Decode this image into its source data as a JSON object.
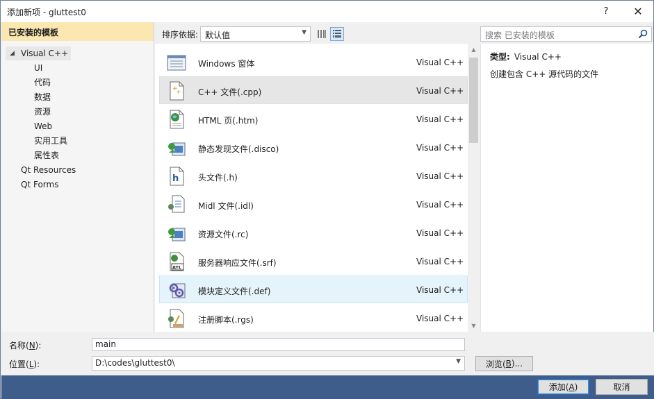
{
  "window": {
    "title": "添加新项 - gluttest0",
    "help": "?",
    "close": "✕"
  },
  "left": {
    "header": "已安装的模板",
    "root": "Visual C++",
    "children": [
      "UI",
      "代码",
      "数据",
      "资源",
      "Web",
      "实用工具",
      "属性表"
    ],
    "extra": [
      "Qt Resources",
      "Qt Forms"
    ]
  },
  "toolbar": {
    "sort_label": "排序依据:",
    "sort_value": "默认值",
    "search_placeholder": "搜索 已安装的模板"
  },
  "items": [
    {
      "name": "Windows 窗体",
      "lang": "Visual C++",
      "icon": "form-icon"
    },
    {
      "name": "C++ 文件(.cpp)",
      "lang": "Visual C++",
      "icon": "cpp-file-icon"
    },
    {
      "name": "HTML 页(.htm)",
      "lang": "Visual C++",
      "icon": "html-file-icon"
    },
    {
      "name": "静态发现文件(.disco)",
      "lang": "Visual C++",
      "icon": "disco-file-icon"
    },
    {
      "name": "头文件(.h)",
      "lang": "Visual C++",
      "icon": "header-file-icon"
    },
    {
      "name": "Midl 文件(.idl)",
      "lang": "Visual C++",
      "icon": "idl-file-icon"
    },
    {
      "name": "资源文件(.rc)",
      "lang": "Visual C++",
      "icon": "rc-file-icon"
    },
    {
      "name": "服务器响应文件(.srf)",
      "lang": "Visual C++",
      "icon": "srf-file-icon"
    },
    {
      "name": "模块定义文件(.def)",
      "lang": "Visual C++",
      "icon": "def-file-icon"
    },
    {
      "name": "注册脚本(.rgs)",
      "lang": "Visual C++",
      "icon": "rgs-file-icon"
    }
  ],
  "detail": {
    "type_label": "类型:",
    "type_value": "Visual C++",
    "description": "创建包含 C++ 源代码的文件"
  },
  "form": {
    "name_label_pre": "名称(",
    "name_label_key": "N",
    "name_label_post": "):",
    "name_value": "main",
    "location_label_pre": "位置(",
    "location_label_key": "L",
    "location_label_post": "):",
    "location_value": "D:\\codes\\gluttest0\\",
    "browse_pre": "浏览(",
    "browse_key": "B",
    "browse_post": ")..."
  },
  "buttons": {
    "add_pre": "添加(",
    "add_key": "A",
    "add_post": ")",
    "cancel": "取消"
  }
}
